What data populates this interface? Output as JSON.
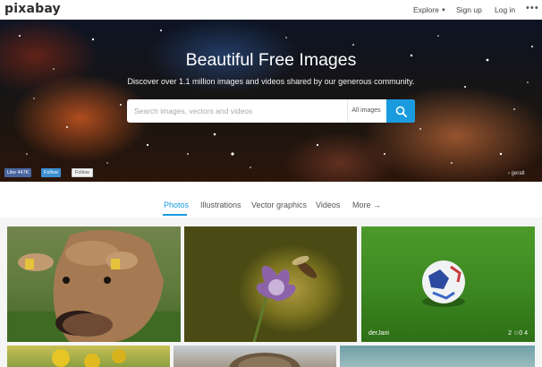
{
  "header": {
    "logo": "pixabay",
    "nav": {
      "explore": "Explore",
      "signup": "Sign up",
      "login": "Log in"
    },
    "more_icon": "more-dots-icon"
  },
  "hero": {
    "title": "Beautiful Free Images",
    "subtitle": "Discover over 1.1 million images and videos shared by our generous community.",
    "search": {
      "placeholder": "Search images, vectors and videos",
      "value": "",
      "type_label": "All images",
      "button_icon": "search-icon"
    },
    "social": {
      "facebook": "Like 447K",
      "twitter": "Follow",
      "gplus": "Follow"
    },
    "credit": "geralt"
  },
  "tabs": [
    {
      "label": "Photos",
      "active": true
    },
    {
      "label": "Illustrations",
      "active": false
    },
    {
      "label": "Vector graphics",
      "active": false
    },
    {
      "label": "Videos",
      "active": false
    },
    {
      "label": "More →",
      "active": false
    }
  ],
  "tiles": [
    {
      "subject": "cow"
    },
    {
      "subject": "purple flower with wasp"
    },
    {
      "subject": "soccer ball on grass",
      "author": "derJani",
      "stats": "2 ☆0 4"
    },
    {
      "subject": "yellow flowers"
    },
    {
      "subject": "hedgehog"
    },
    {
      "subject": "water"
    }
  ],
  "colors": {
    "accent": "#1a9be0"
  }
}
